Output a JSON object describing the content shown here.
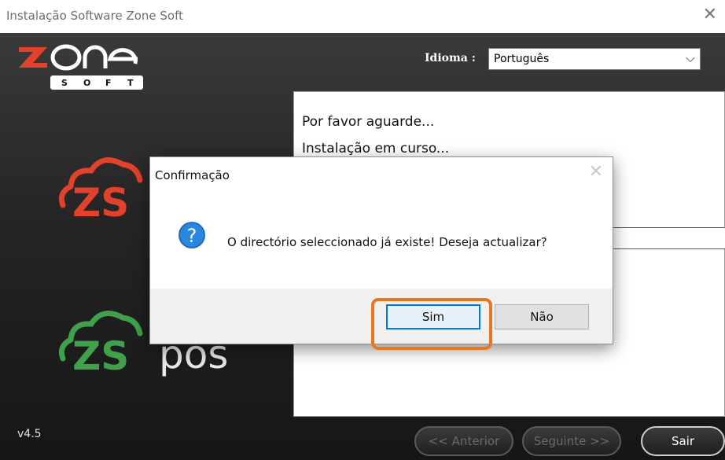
{
  "window": {
    "title": "Instalação Software Zone Soft",
    "close_glyph": "✕"
  },
  "installer": {
    "language": {
      "label": "Idioma :",
      "value": "Português"
    },
    "status_lines": [
      "Por favor aguarde...",
      "Instalação em curso..."
    ],
    "brand_pos": "pos",
    "version": "v4.5",
    "buttons": {
      "previous": "<< Anterior",
      "next": "Seguinte >>",
      "exit": "Sair"
    }
  },
  "dialog": {
    "title": "Confirmação",
    "message": "O directório seleccionado já existe! Deseja actualizar?",
    "icon": "question-icon",
    "buttons": {
      "yes": "Sim",
      "no": "Não"
    }
  },
  "colors": {
    "highlight": "#e87722",
    "zs_red": "#e2412c",
    "zs_green": "#3fa14a",
    "focus_blue": "#0078d7"
  }
}
